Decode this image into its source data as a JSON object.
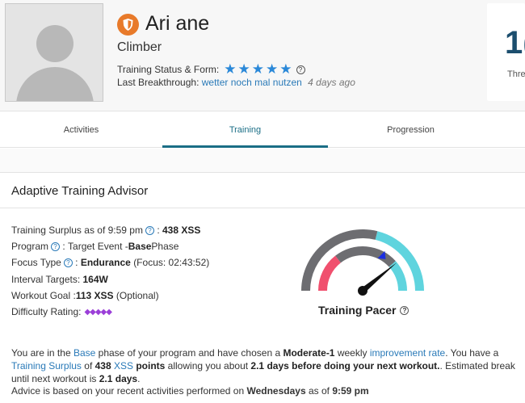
{
  "profile": {
    "name": "Ari ane",
    "role": "Climber",
    "status_label": "Training Status & Form:",
    "stars": 5,
    "breakthrough_label": "Last Breakthrough:",
    "breakthrough_link": "wetter noch mal nutzen",
    "breakthrough_ago": "4 days ago",
    "stat_number": "1(",
    "stat_label": "Thres"
  },
  "tabs": [
    "Activities",
    "Training",
    "Progression"
  ],
  "active_tab": "Training",
  "panel": {
    "title": "Adaptive Training Advisor"
  },
  "metrics": {
    "surplus_label": "Training Surplus as of 9:59 pm",
    "surplus_value": "438 XSS",
    "program_label": "Program",
    "program_value_a": "Target Event - ",
    "program_value_b": "Base",
    "program_value_c": " Phase",
    "focus_label": "Focus Type",
    "focus_value": "Endurance",
    "focus_detail": "(Focus: 02:43:52)",
    "interval_label": "Interval Targets:",
    "interval_value": "164W",
    "goal_label": "Workout Goal : ",
    "goal_value": "113 XSS",
    "goal_detail": "(Optional)",
    "difficulty_label": "Difficulty Rating:",
    "difficulty_diamonds": "◆◆◆◆◆"
  },
  "gauge": {
    "label": "Training Pacer",
    "colors": {
      "dark": "#6d6d71",
      "pink": "#f0506e",
      "teal": "#5fd4de",
      "needle": "#111111",
      "marker": "#1a2ee0"
    },
    "needle_fraction": 0.78
  },
  "summary": {
    "p1": "You are in the ",
    "phase": "Base",
    "p2": " phase of your program and have chosen a ",
    "rate_value": "Moderate-1",
    "p3": " weekly ",
    "rate_link": "improvement rate",
    "p4": ". You have a ",
    "surplus_link": "Training Surplus",
    "p5": " of ",
    "surplus_points": "438",
    "xss_link": "XSS",
    "points_word": " points",
    "p6": " allowing you about ",
    "days": "2.1 days",
    "next": "before doing your next workout.",
    "p7": ". Estimated break until next workout is ",
    "break_days": "2.1 days",
    "p8": "."
  },
  "advice": {
    "p1": "Advice is based on your recent activities performed on ",
    "days": "Wednesdays",
    "p2": " as of ",
    "time": "9:59 pm"
  },
  "help_glyph": "?"
}
